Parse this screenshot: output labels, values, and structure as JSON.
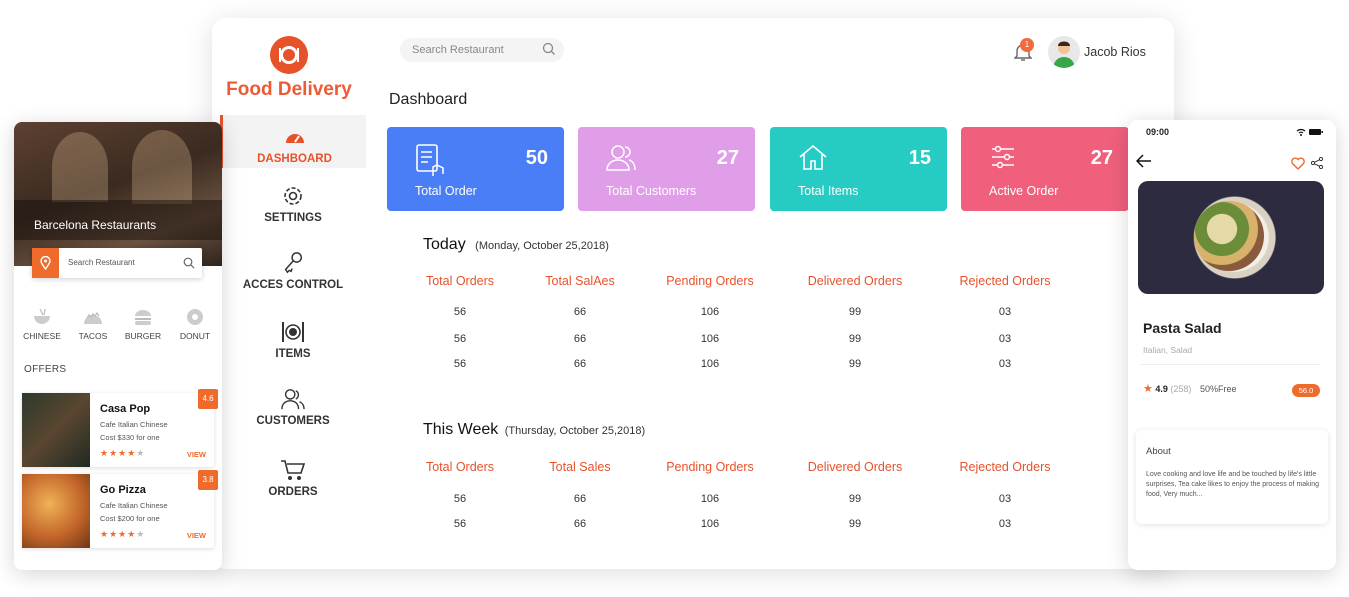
{
  "dashboard": {
    "brand": "Food Delivery",
    "nav": [
      {
        "label": "DASHBOARD",
        "icon": "speedometer-icon"
      },
      {
        "label": "SETTINGS",
        "icon": "gear-icon"
      },
      {
        "label": "ACCES CONTROL",
        "icon": "key-icon"
      },
      {
        "label": "ITEMS",
        "icon": "plate-cutlery-icon"
      },
      {
        "label": "CUSTOMERS",
        "icon": "users-icon"
      },
      {
        "label": "ORDERS",
        "icon": "cart-icon"
      }
    ],
    "search_placeholder": "Search Restaurant",
    "notification_count": "1",
    "user_name": "Jacob Rios",
    "page_title": "Dashboard",
    "stats": [
      {
        "label": "Total Order",
        "value": "50",
        "color": "#4a7ef7",
        "icon": "checklist-touch-icon"
      },
      {
        "label": "Total Customers",
        "value": "27",
        "color": "#e09ee8",
        "icon": "users-icon"
      },
      {
        "label": "Total Items",
        "value": "15",
        "color": "#26ccc4",
        "icon": "house-icon"
      },
      {
        "label": "Active Order",
        "value": "27",
        "color": "#f0607d",
        "icon": "sliders-icon"
      }
    ],
    "today": {
      "title": "Today",
      "date": "(Monday, October 25,2018)",
      "headers": [
        "Total Orders",
        "Total SalAes",
        "Pending Orders",
        "Delivered Orders",
        "Rejected Orders"
      ],
      "rows": [
        [
          "56",
          "66",
          "106",
          "99",
          "03"
        ],
        [
          "56",
          "66",
          "106",
          "99",
          "03"
        ],
        [
          "56",
          "66",
          "106",
          "99",
          "03"
        ]
      ]
    },
    "week": {
      "title": "This Week",
      "date": "(Thursday, October 25,2018)",
      "headers": [
        "Total Orders",
        "Total Sales",
        "Pending Orders",
        "Delivered Orders",
        "Rejected Orders"
      ],
      "rows": [
        [
          "56",
          "66",
          "106",
          "99",
          "03"
        ],
        [
          "56",
          "66",
          "106",
          "99",
          "03"
        ]
      ]
    }
  },
  "left_phone": {
    "hero_title": "Barcelona Restaurants",
    "search_placeholder": "Search Restaurant",
    "categories": [
      {
        "label": "CHINESE",
        "icon": "bowl-icon"
      },
      {
        "label": "TACOS",
        "icon": "taco-icon"
      },
      {
        "label": "BURGER",
        "icon": "burger-icon"
      },
      {
        "label": "DONUT",
        "icon": "donut-icon"
      }
    ],
    "offers_label": "OFFERS",
    "offers": [
      {
        "name": "Casa Pop",
        "cuisine": "Cafe Italian Chinese",
        "cost": "Cost $330 for one",
        "rating": "4.6",
        "stars": 4,
        "view": "VIEW"
      },
      {
        "name": "Go Pizza",
        "cuisine": "Cafe Italian Chinese",
        "cost": "Cost $200 for one",
        "rating": "3.8",
        "stars": 4,
        "view": "VIEW"
      }
    ]
  },
  "right_phone": {
    "time": "09:00",
    "dish_name": "Pasta Salad",
    "dish_tags": "Italian, Salad",
    "rating": "4.9",
    "reviews": "(258)",
    "promo": "50%Free",
    "price": "56.0",
    "about_title": "About",
    "about_text": "Love cooking and love life and be touched by life's little surprises, Tea cake likes to enjoy the process of making food, Very much..."
  },
  "colors": {
    "accent": "#e8522b",
    "orange": "#ee6b2c"
  }
}
